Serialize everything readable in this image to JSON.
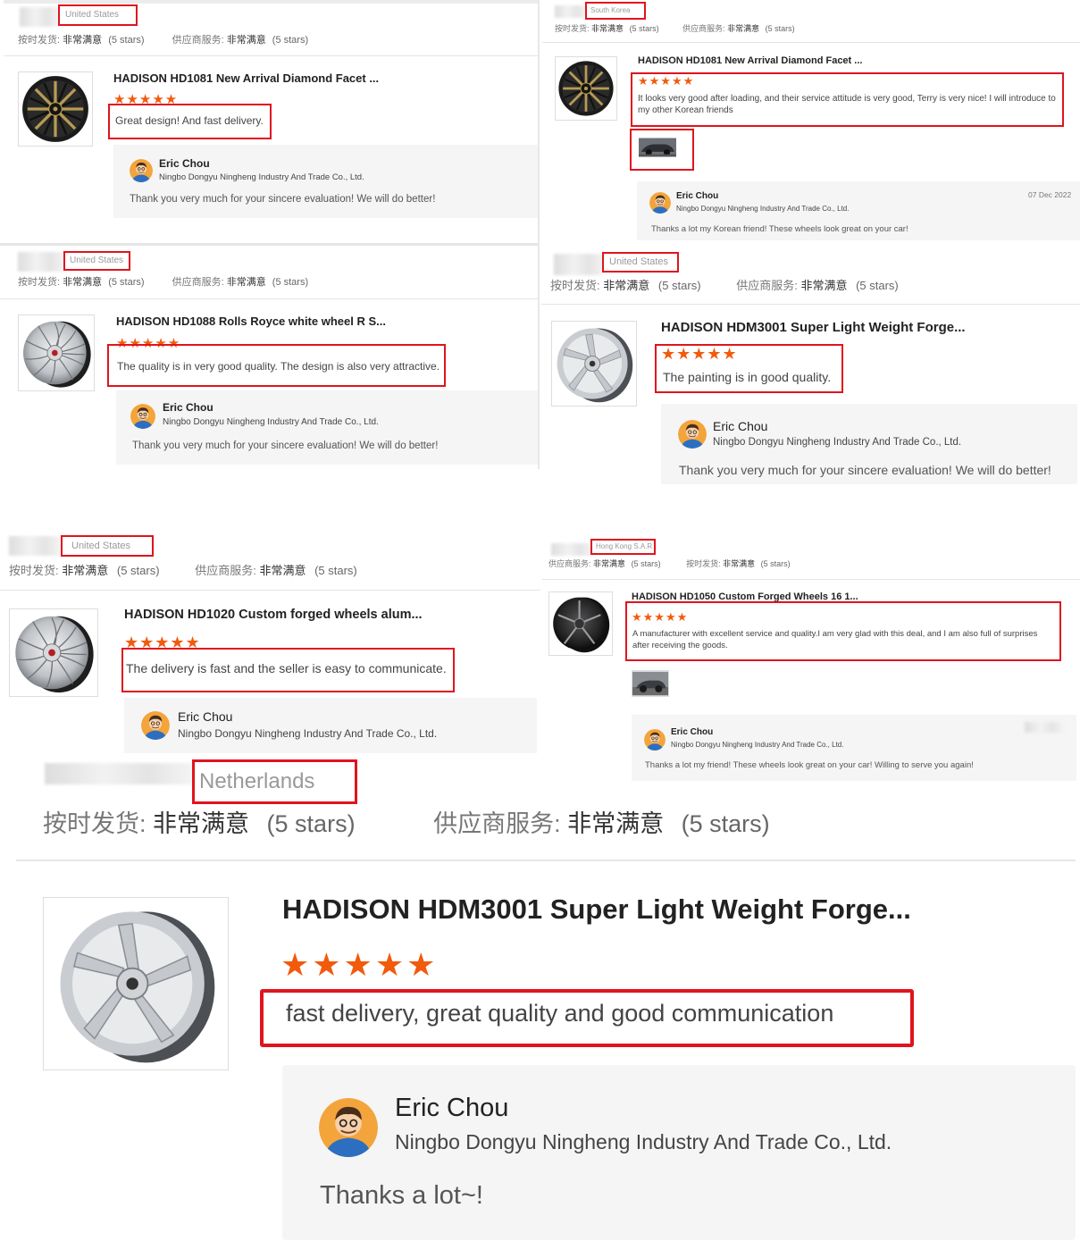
{
  "rating_text": {
    "delivery_label": "按时发货:",
    "service_label": "供应商服务:",
    "very_satisfied": "非常满意",
    "five_stars": "(5 stars)",
    "star_glyphs": "★★★★★"
  },
  "reviews": [
    {
      "country": "United States",
      "product_title": "HADISON HD1081 New Arrival Diamond Facet ...",
      "review_text": "Great design! And fast delivery.",
      "reply_name": "Eric Chou",
      "reply_company": "Ningbo Dongyu Ningheng Industry And Trade Co., Ltd.",
      "reply_text": "Thank you very much for your sincere evaluation! We will do better!",
      "wheel_style": "black-gold"
    },
    {
      "country": "South Korea",
      "product_title": "HADISON HD1081 New Arrival Diamond Facet ...",
      "review_text": "It looks very good after loading, and their service attitude is very good, Terry is very nice!  I will introduce to my other Korean friends",
      "reply_name": "Eric Chou",
      "reply_company": "Ningbo Dongyu Ningheng Industry And Trade Co., Ltd.",
      "reply_text": "Thanks a lot my Korean friend!  These wheels look great on your car!",
      "reply_date": "07 Dec 2022",
      "wheel_style": "black-gold"
    },
    {
      "country": "United States",
      "product_title": "HADISON HD1088 Rolls Royce white wheel R S...",
      "review_text": "The quality is in very good quality. The design is also very attractive.",
      "reply_name": "Eric Chou",
      "reply_company": "Ningbo Dongyu Ningheng Industry And Trade Co., Ltd.",
      "reply_text": "Thank you very much for your sincere evaluation! We will do better!",
      "wheel_style": "silver-turbine"
    },
    {
      "country": "United States",
      "product_title": "HADISON HDM3001 Super Light Weight Forge...",
      "review_text": "The painting is in good quality.",
      "reply_name": "Eric Chou",
      "reply_company": "Ningbo Dongyu Ningheng Industry And Trade Co., Ltd.",
      "reply_text": "Thank you very much for your sincere evaluation! We will do better!",
      "wheel_style": "silver-spoke"
    },
    {
      "country": "United States",
      "product_title": "HADISON HD1020 Custom forged wheels alum...",
      "review_text": "The delivery is fast and the seller is easy to communicate.",
      "reply_name": "Eric Chou",
      "reply_company": "Ningbo Dongyu Ningheng Industry And Trade Co., Ltd.",
      "wheel_style": "silver-turbine"
    },
    {
      "country": "Hong Kong S.A.R",
      "product_title": "HADISON HD1050 Custom Forged Wheels 16 1...",
      "review_text": "A manufacturer with excellent service and quality.I am very glad with this deal, and I am also full of surprises after receiving the goods.",
      "reply_name": "Eric Chou",
      "reply_company": "Ningbo Dongyu Ningheng Industry And Trade Co., Ltd.",
      "reply_text": "Thanks a lot my friend!  These wheels look great on your car! Willing to serve you again!",
      "wheel_style": "dark-spoke"
    },
    {
      "country": "Netherlands",
      "product_title": "HADISON HDM3001 Super Light Weight Forge...",
      "review_text": "fast delivery, great quality and good communication",
      "reply_name": "Eric Chou",
      "reply_company": "Ningbo Dongyu Ningheng Industry And Trade Co., Ltd.",
      "reply_text": "Thanks a lot~!",
      "wheel_style": "silver-spoke"
    }
  ],
  "colors": {
    "highlight_border": "#e0141e",
    "star": "#f25a0c",
    "reply_background": "#f5f5f5"
  }
}
